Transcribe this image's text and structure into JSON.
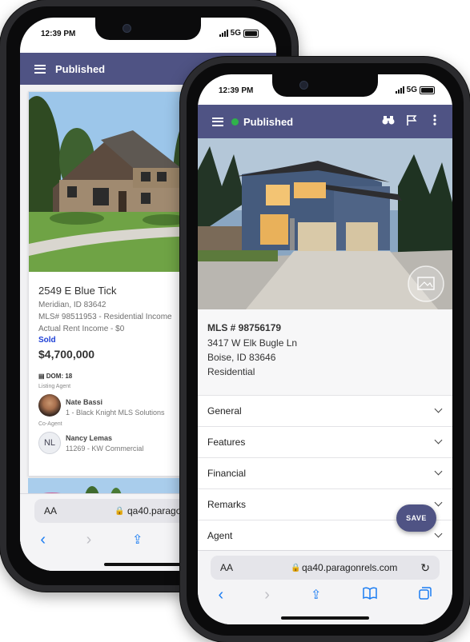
{
  "phone_back": {
    "status": {
      "time": "12:39 PM",
      "network": "5G"
    },
    "appbar": {
      "title": "Published"
    },
    "listing": {
      "address": "2549 E Blue Tick",
      "city": "Meridian, ID 83642",
      "mls_line": "MLS# 98511953 - Residential Income",
      "rent_line": "Actual Rent Income - $0",
      "status": "Sold",
      "price": "$4,700,000",
      "dom": "DOM: 18",
      "listing_agent_label": "Listing Agent",
      "listing_agent_name": "Nate Bassi",
      "listing_agent_org": "1 - Black Knight MLS Solutions",
      "co_agent_label": "Co-Agent",
      "co_agent_initials": "NL",
      "co_agent_name": "Nancy Lemas",
      "co_agent_org": "11269 - KW Commercial"
    },
    "safari": {
      "text_size": "AA",
      "url": "qa40.paragonrels.com"
    }
  },
  "phone_front": {
    "status": {
      "time": "12:39 PM",
      "network": "5G"
    },
    "appbar": {
      "title": "Published",
      "status_color": "#2fb34a"
    },
    "listing": {
      "mls": "MLS # 98756179",
      "street": "3417 W Elk Bugle Ln",
      "city": "Boise, ID 83646",
      "type": "Residential"
    },
    "sections": [
      "General",
      "Features",
      "Financial",
      "Remarks",
      "Agent"
    ],
    "save_label": "SAVE",
    "safari": {
      "text_size": "AA",
      "url": "qa40.paragonrels.com"
    }
  },
  "colors": {
    "appbar": "#4f5384",
    "safari_blue": "#1a7cf2",
    "sold_blue": "#1d3fd6"
  }
}
